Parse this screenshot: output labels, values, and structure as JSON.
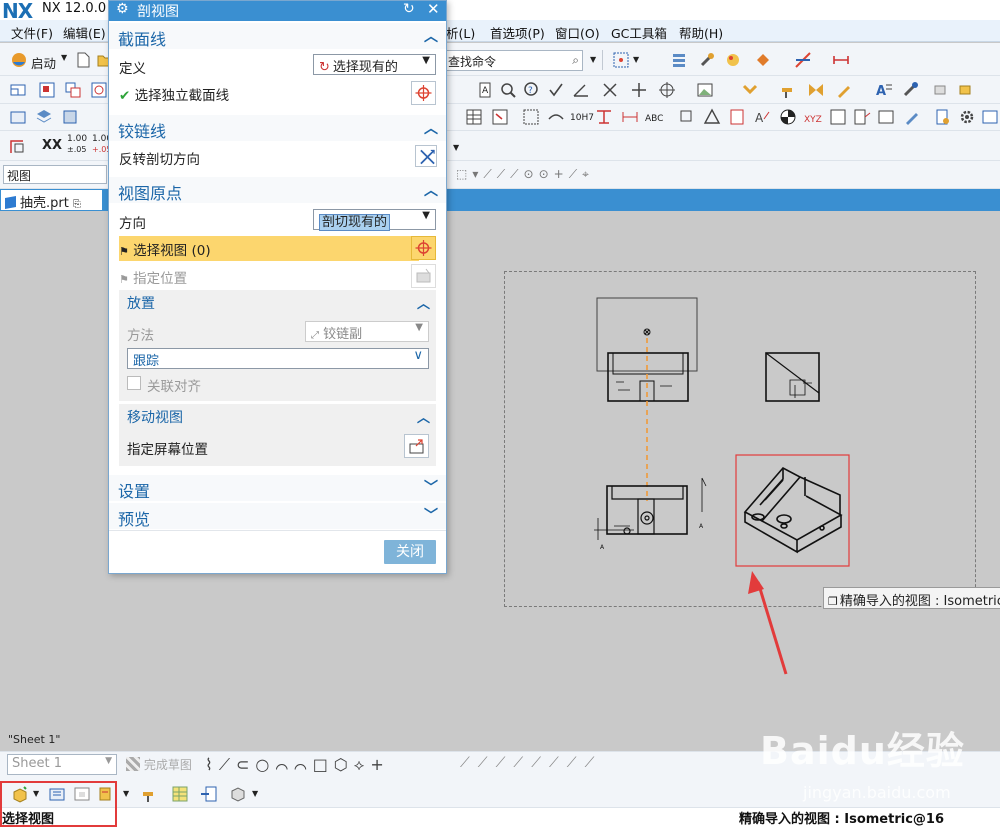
{
  "app": {
    "logo": "NX",
    "title": "NX 12.0.0"
  },
  "menu": [
    {
      "label": "文件(F)"
    },
    {
      "label": "编辑(E)"
    },
    {
      "label": "析(L)"
    },
    {
      "label": "首选项(P)"
    },
    {
      "label": "窗口(O)"
    },
    {
      "label": "GC工具箱"
    },
    {
      "label": "帮助(H)"
    }
  ],
  "toolbar": {
    "start_label": "启动",
    "search_placeholder": "查找命令",
    "view_filter": "视图",
    "xx_label": "XX",
    "tol1": "1.00",
    "tol1_sub": "±.05",
    "tol2": "1.00",
    "tol2_sub": "+.05",
    "dim_10h7": "10H7",
    "dim_abc": "ABC",
    "dim_xyz": "XYZ"
  },
  "tab": {
    "file": "抽壳.prt"
  },
  "canvas": {
    "sheet_label": "\"Sheet 1\"",
    "tooltip": "精确导入的视图 : Isometric"
  },
  "dialog": {
    "title": "剖视图",
    "reset_icon": "↻",
    "close_icon": "✕",
    "sections": {
      "section_line": {
        "title": "截面线",
        "define_label": "定义",
        "define_value": "选择现有的",
        "select_independent": "选择独立截面线"
      },
      "hinge_line": {
        "title": "铰链线",
        "reverse_label": "反转剖切方向"
      },
      "view_origin": {
        "title": "视图原点",
        "direction_label": "方向",
        "direction_value": "剖切现有的",
        "select_view": "选择视图 (0)",
        "specify_location": "指定位置",
        "placement": {
          "title": "放置",
          "method_label": "方法",
          "method_value": "铰链副",
          "track_value": "跟踪",
          "associative_align": "关联对齐"
        },
        "move_view": {
          "title": "移动视图",
          "screen_position": "指定屏幕位置"
        }
      },
      "settings": {
        "title": "设置"
      },
      "preview": {
        "title": "预览"
      }
    },
    "close_button": "关闭"
  },
  "bottom": {
    "sheet_dropdown": "Sheet 1",
    "finish_sketch": "完成草图"
  },
  "status": {
    "left": "选择视图",
    "right": "精确导入的视图 : Isometric@16"
  },
  "watermark": {
    "text": "Baidu经验",
    "url": "jingyan.baidu.com"
  },
  "colors": {
    "accent": "#3a8fd1",
    "section_title": "#1b66a8",
    "highlight": "#fcd66e",
    "red_annotation": "#e23b3b",
    "center_line": "#f09a3a"
  }
}
